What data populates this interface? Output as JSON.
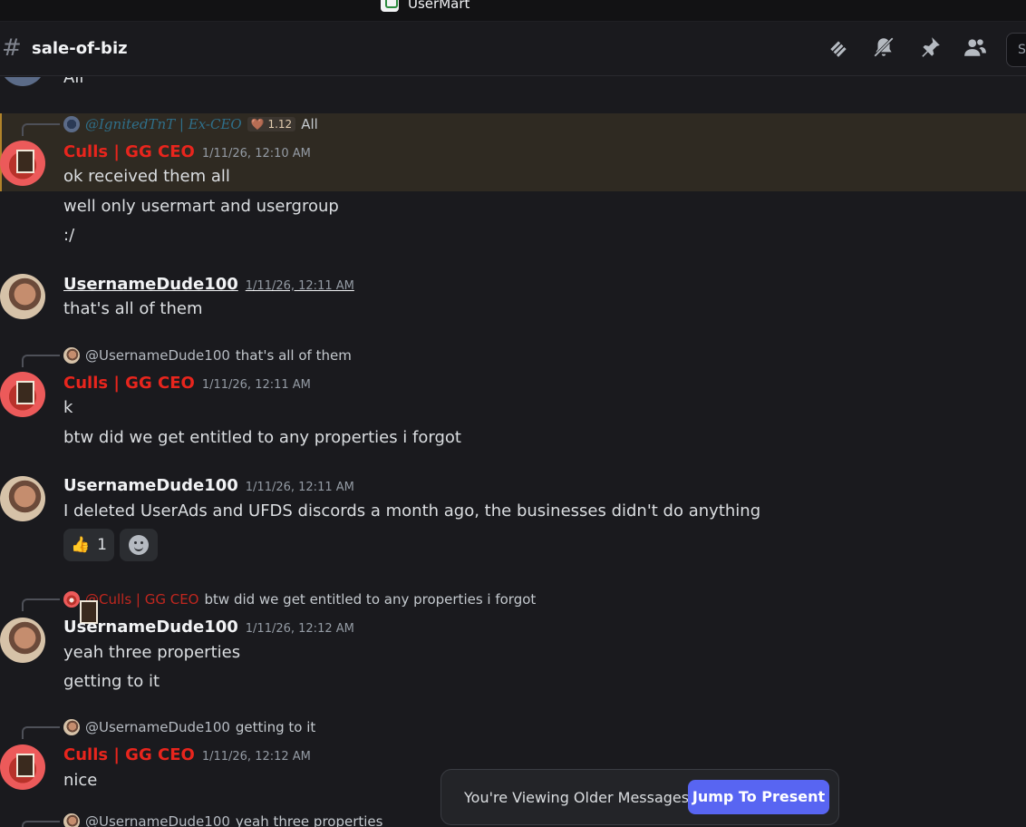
{
  "window": {
    "title": "UserMart"
  },
  "header": {
    "hash": "#",
    "channel": "sale-of-biz",
    "search_placeholder": "S"
  },
  "messages": {
    "top_partial": {
      "text": "All"
    },
    "m1": {
      "reply_name": "@IgnitedTnT | Ex-CEO",
      "reply_tag": "🤎 1.12",
      "reply_text": "All",
      "author": "Culls | GG CEO",
      "timestamp": "1/11/26, 12:10 AM",
      "lines": [
        "ok received them all",
        "well only usermart and usergroup",
        ":/"
      ]
    },
    "m2": {
      "author": "UsernameDude100",
      "timestamp": "1/11/26, 12:11 AM",
      "lines": [
        "that's all of them"
      ]
    },
    "m3": {
      "reply_name": "@UsernameDude100",
      "reply_text": "that's all of them",
      "author": "Culls | GG CEO",
      "timestamp": "1/11/26, 12:11 AM",
      "lines": [
        "k",
        "btw did we get entitled to any properties i forgot"
      ]
    },
    "m4": {
      "author": "UsernameDude100",
      "timestamp": "1/11/26, 12:11 AM",
      "lines": [
        "I deleted UserAds and UFDS discords a month ago, the businesses didn't do anything"
      ],
      "reaction_emoji": "👍",
      "reaction_count": "1"
    },
    "m5": {
      "reply_name": "@Culls | GG CEO",
      "reply_text": "btw did we get entitled to any properties i forgot",
      "author": "UsernameDude100",
      "timestamp": "1/11/26, 12:12 AM",
      "lines": [
        "yeah three properties",
        "getting to it"
      ]
    },
    "m6": {
      "reply_name": "@UsernameDude100",
      "reply_text": "getting to it",
      "author": "Culls | GG CEO",
      "timestamp": "1/11/26, 12:12 AM",
      "lines": [
        "nice"
      ]
    },
    "m7_partial": {
      "reply_name": "@UsernameDude100",
      "reply_text": "yeah three properties"
    }
  },
  "older_bar": {
    "label": "You're Viewing Older Messages",
    "button": "Jump To Present"
  },
  "colors": {
    "accent": "#5865f2",
    "culls": "#e8251d",
    "highlight": "#2f2a22"
  }
}
